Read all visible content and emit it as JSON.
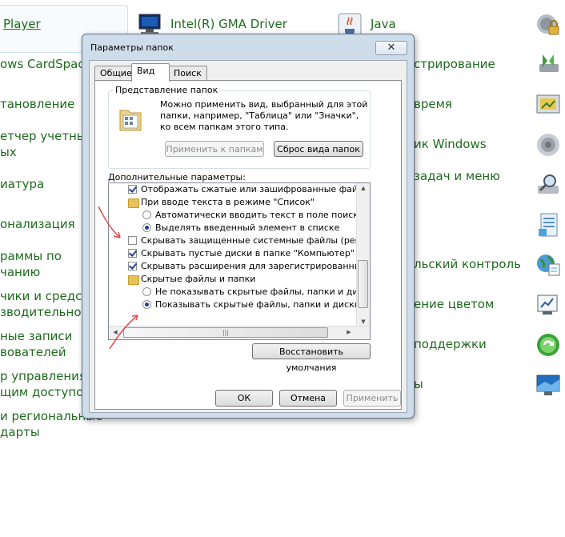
{
  "control_panel": {
    "items_left": [
      "Player",
      "ows CardSpace",
      "тановление",
      "етчер учетных",
      "ых",
      "иатура",
      "онализация",
      "раммы по",
      "чанию",
      "чики и средства",
      "зводительност",
      "ные записи",
      "вователей",
      "р управления с",
      "щим доступом",
      "и региональные",
      "дарты"
    ],
    "items_mid": [
      "Intel(R) GMA Driver",
      "Java",
      "стрирование",
      "время",
      "ик Windows",
      "задач и меню",
      "льский контроль",
      "ение цветом",
      "поддержки",
      "ы"
    ],
    "icon_names": [
      "intel-icon",
      "java-icon",
      "lock-icon",
      "sync-icon",
      "monitor-icon",
      "speaker-icon",
      "search-icon",
      "document-icon",
      "globe-icon",
      "computer-icon",
      "refresh-icon",
      "display-icon"
    ]
  },
  "dialog": {
    "title": "Параметры папок",
    "close_label": "✕",
    "tabs": [
      "Общие",
      "Вид",
      "Поиск"
    ],
    "view_group": {
      "label": "Представление папок",
      "description": "Можно применить вид, выбранный для этой папки, например, \"Таблица\" или \"Значки\", ко всем папкам этого типа.",
      "apply_button": "Применить к папкам",
      "reset_button": "Сброс вида папок"
    },
    "advanced_label": "Дополнительные параметры:",
    "tree_items": [
      "Отображать сжатые или зашифрованные файлы NTFS",
      "При вводе текста в режиме \"Список\"",
      "Автоматически вводить текст в поле поиска",
      "Выделять введенный элемент в списке",
      "Скрывать защищенные системные файлы (рекомендуется)",
      "Скрывать пустые диски в папке \"Компьютер\"",
      "Скрывать расширения для зарегистрированных типов",
      "Скрытые файлы и папки",
      "Не показывать скрытые файлы, папки и диски",
      "Показывать скрытые файлы, папки и диски"
    ],
    "hscroll_grip": "|||",
    "restore_button": "Восстановить умолчания",
    "ok_button": "ОК",
    "cancel_button": "Отмена",
    "apply_button": "Применить"
  },
  "colors": {
    "link_green": "#1e6b1e",
    "annotation_arrow": "#e8474a",
    "dialog_frame": "#cfdcea"
  }
}
